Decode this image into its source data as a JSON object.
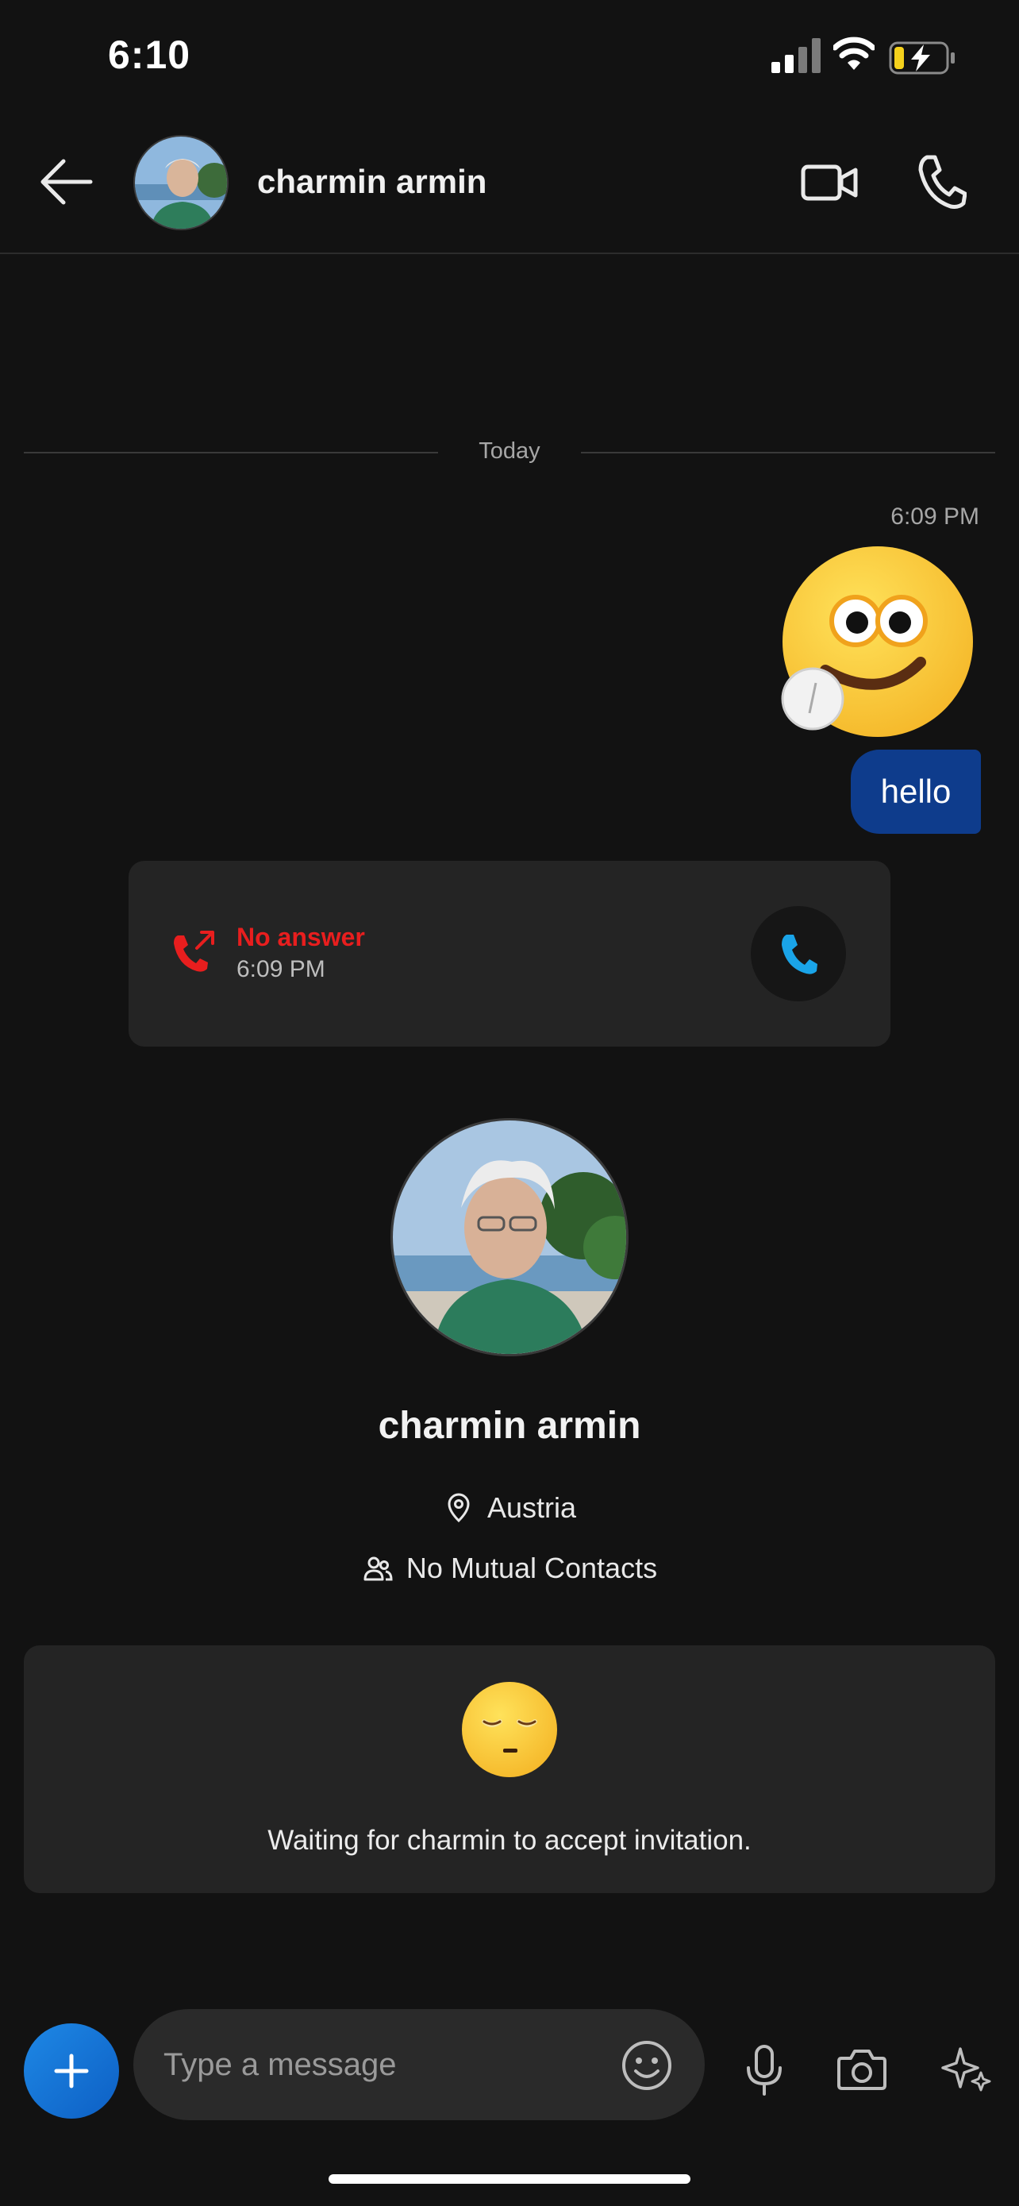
{
  "status_bar": {
    "time": "6:10"
  },
  "header": {
    "back_icon": "arrow-left-icon",
    "contact_name": "charmin armin",
    "video_icon": "video-camera-icon",
    "call_icon": "phone-icon"
  },
  "conversation": {
    "date_divider": "Today",
    "sent_time": "6:09 PM",
    "sticker": "winking-emoji-sticker",
    "message_text": "hello",
    "call": {
      "status": "No answer",
      "time": "6:09 PM",
      "status_color": "#e81e1e",
      "callback_icon": "phone-icon"
    }
  },
  "profile": {
    "name": "charmin armin",
    "location": "Austria",
    "location_icon": "location-pin-icon",
    "mutual_contacts": "No Mutual Contacts",
    "mutual_icon": "people-icon"
  },
  "invitation": {
    "emoji": "sleepy-face-emoji",
    "text": "Waiting for charmin to accept invitation."
  },
  "composer": {
    "placeholder": "Type a message",
    "plus_icon": "plus-icon",
    "emoji_icon": "smiley-icon",
    "mic_icon": "microphone-icon",
    "camera_icon": "camera-icon",
    "ai_icon": "sparkle-icon"
  },
  "colors": {
    "background": "#121212",
    "card": "#242424",
    "sent_bubble": "#0e3c8c",
    "accent": "#1e88e5",
    "callback_icon": "#1aa4e8"
  }
}
